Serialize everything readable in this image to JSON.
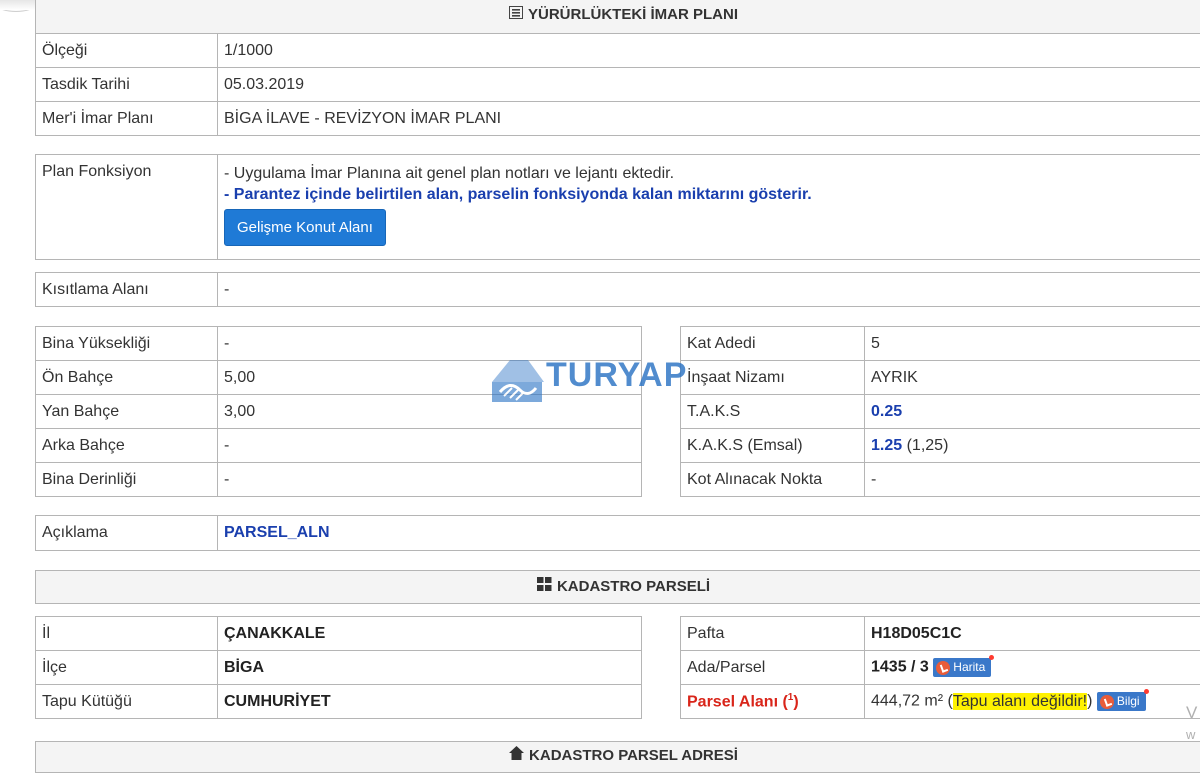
{
  "section_imar": {
    "title": "YÜRÜRLÜKTEKİ İMAR PLANI",
    "rows": [
      {
        "label": "Ölçeği",
        "value": "1/1000"
      },
      {
        "label": "Tasdik Tarihi",
        "value": "05.03.2019"
      },
      {
        "label": "Mer'i İmar Planı",
        "value": "BİGA İLAVE - REVİZYON İMAR PLANI"
      }
    ]
  },
  "plan_fonksiyon": {
    "label": "Plan Fonksiyon",
    "note1": "- Uygulama İmar Planına ait genel plan notları ve lejantı ektedir.",
    "note2": "- Parantez içinde belirtilen alan, parselin fonksiyonda kalan miktarını gösterir.",
    "button": "Gelişme Konut Alanı"
  },
  "kisitlama": {
    "label": "Kısıtlama Alanı",
    "value": "-"
  },
  "left_params": [
    {
      "label": "Bina Yüksekliği",
      "value": "-"
    },
    {
      "label": "Ön Bahçe",
      "value": "5,00"
    },
    {
      "label": "Yan Bahçe",
      "value": "3,00"
    },
    {
      "label": "Arka Bahçe",
      "value": "-"
    },
    {
      "label": "Bina Derinliği",
      "value": "-"
    }
  ],
  "right_params": {
    "kat_label": "Kat Adedi",
    "kat_value": "5",
    "nizam_label": "İnşaat Nizamı",
    "nizam_value": "AYRIK",
    "taks_label": "T.A.K.S",
    "taks_value": "0.25",
    "kaks_label": "K.A.K.S (Emsal)",
    "kaks_value": "1.25",
    "kaks_extra": "(1,25)",
    "kot_label": "Kot Alınacak Nokta",
    "kot_value": "-"
  },
  "aciklama": {
    "label": "Açıklama",
    "value": "PARSEL_ALN"
  },
  "watermark": {
    "text": "TURYAP"
  },
  "section_kadastro": {
    "title": "KADASTRO PARSELİ"
  },
  "kadastro_left": [
    {
      "label": "İl",
      "value": "ÇANAKKALE"
    },
    {
      "label": "İlçe",
      "value": "BİGA"
    },
    {
      "label": "Tapu Kütüğü",
      "value": "CUMHURİYET"
    }
  ],
  "kadastro_right": {
    "pafta_label": "Pafta",
    "pafta_value": "H18D05C1C",
    "ada_label": "Ada/Parsel",
    "ada_value": "1435 / 3",
    "harita_label": "Harita",
    "alan_label": "Parsel Alanı (",
    "alan_sup": "1",
    "alan_label_end": ")",
    "alan_value": "444,72 m² (",
    "tapu_note": "Tapu alanı değildir!",
    "alan_close": ")",
    "bilgi_label": "Bilgi"
  },
  "section_adres": {
    "title": "KADASTRO PARSEL ADRESİ"
  },
  "side_clip": {
    "line1": "V",
    "line2": "w"
  }
}
